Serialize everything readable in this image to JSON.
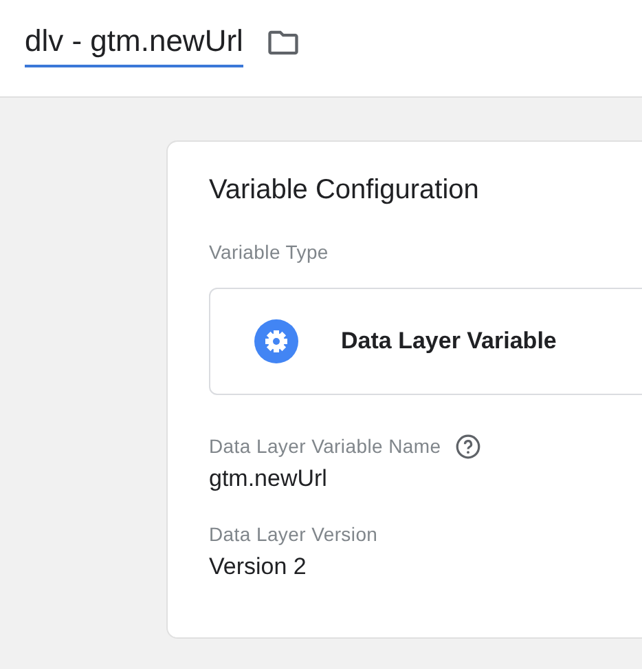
{
  "header": {
    "title": "dlv - gtm.newUrl"
  },
  "card": {
    "title": "Variable Configuration",
    "variable_type": {
      "label": "Variable Type",
      "value": "Data Layer Variable"
    },
    "fields": [
      {
        "label": "Data Layer Variable Name",
        "value": "gtm.newUrl",
        "help": true
      },
      {
        "label": "Data Layer Version",
        "value": "Version 2",
        "help": false
      }
    ]
  }
}
